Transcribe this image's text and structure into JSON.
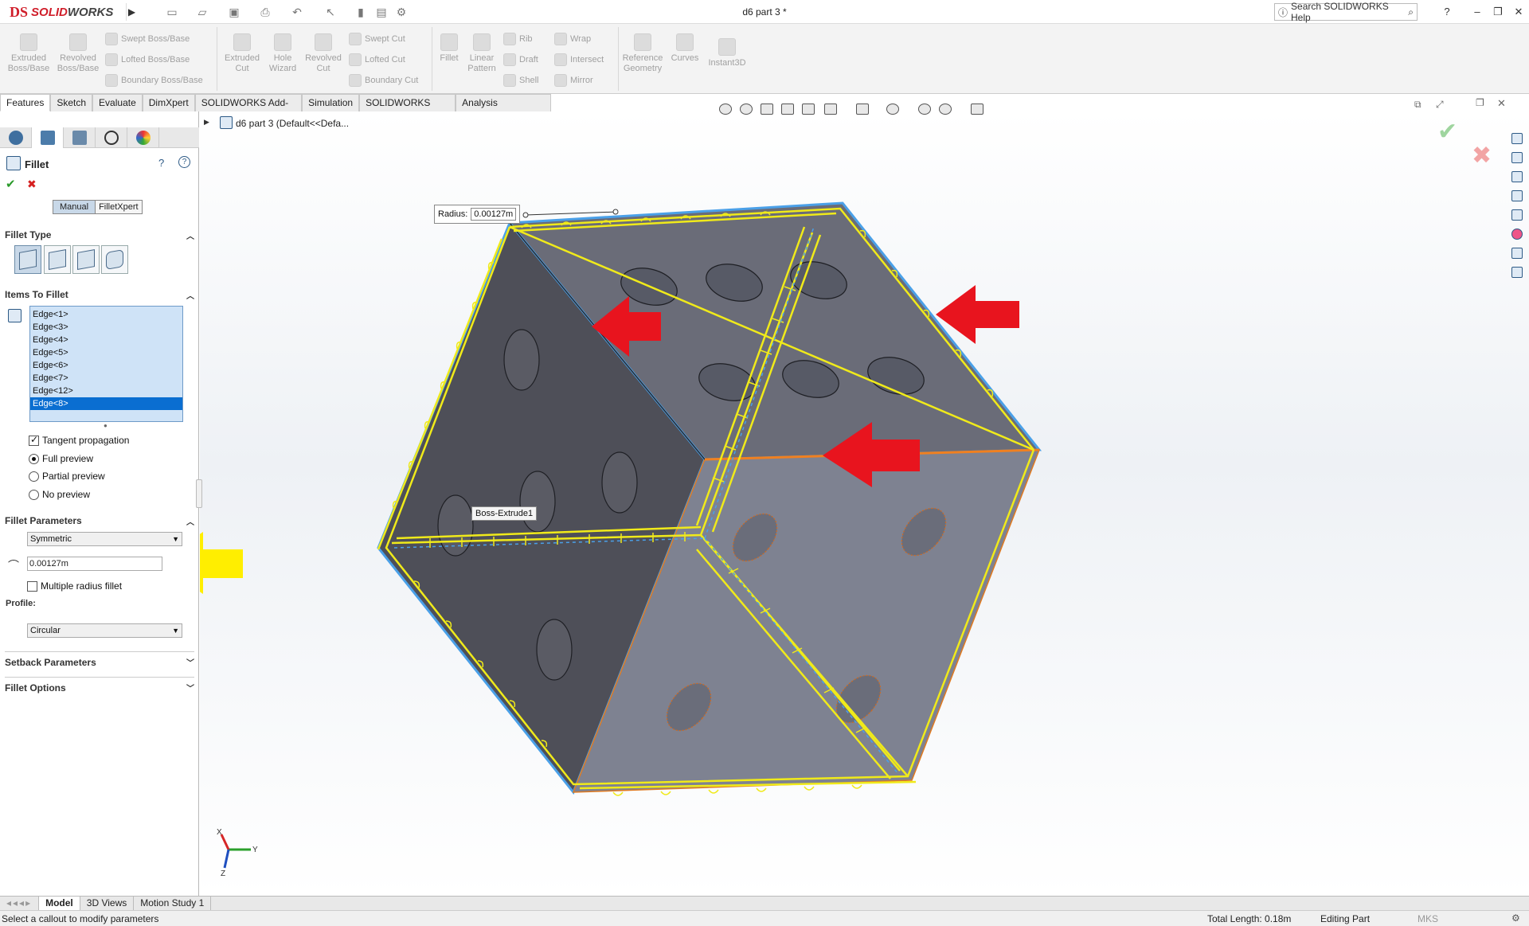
{
  "app": {
    "title": "d6 part 3 *",
    "logo_prefix": "DS",
    "logo_solid": "SOLID",
    "logo_works": "WORKS",
    "search_label": "Search SOLIDWORKS Help"
  },
  "toolbar": {
    "extruded_boss": "Extruded Boss/Base",
    "revolved_boss": "Revolved Boss/Base",
    "swept_boss": "Swept Boss/Base",
    "lofted_boss": "Lofted Boss/Base",
    "boundary_boss": "Boundary Boss/Base",
    "extruded_cut": "Extruded Cut",
    "hole_wizard": "Hole Wizard",
    "revolved_cut": "Revolved Cut",
    "swept_cut": "Swept Cut",
    "lofted_cut": "Lofted Cut",
    "boundary_cut": "Boundary Cut",
    "fillet": "Fillet",
    "linear_pattern": "Linear Pattern",
    "rib": "Rib",
    "draft": "Draft",
    "shell": "Shell",
    "wrap": "Wrap",
    "intersect": "Intersect",
    "mirror": "Mirror",
    "reference_geometry": "Reference Geometry",
    "curves": "Curves",
    "instant3d": "Instant3D"
  },
  "command_tabs": [
    "Features",
    "Sketch",
    "Evaluate",
    "DimXpert",
    "SOLIDWORKS Add-Ins",
    "Simulation",
    "SOLIDWORKS MBD",
    "Analysis Preparation"
  ],
  "tree": {
    "root_label": "d6 part 3  (Default<<Defa..."
  },
  "fillet_panel": {
    "title": "Fillet",
    "mode_manual": "Manual",
    "mode_xpert": "FilletXpert",
    "fillet_type_header": "Fillet Type",
    "items_header": "Items To Fillet",
    "edges": [
      "Edge<1>",
      "Edge<3>",
      "Edge<4>",
      "Edge<5>",
      "Edge<6>",
      "Edge<7>",
      "Edge<12>",
      "Edge<8>"
    ],
    "selected_edge": "Edge<8>",
    "tangent_propagation": "Tangent propagation",
    "tangent_checked": true,
    "full_preview": "Full preview",
    "partial_preview": "Partial preview",
    "no_preview": "No preview",
    "preview_selected": "Full preview",
    "params_header": "Fillet Parameters",
    "symmetric": "Symmetric",
    "radius_value": "0.00127m",
    "multiple_radius": "Multiple radius fillet",
    "profile_label": "Profile:",
    "profile_value": "Circular",
    "setback_header": "Setback Parameters",
    "options_header": "Fillet Options"
  },
  "viewport": {
    "radius_callout_label": "Radius:",
    "radius_callout_value": "0.00127m",
    "boss_tooltip": "Boss-Extrude1",
    "axis_y": "Y",
    "axis_x": "X",
    "axis_z": "Z",
    "colors": {
      "selection_yellow": "#f0ea1a",
      "arrow_red": "#e8141e",
      "arrow_yellow": "#ffee00",
      "edge_blue": "#4aa0e8",
      "edge_orange": "#f08020",
      "face_left": "#4e4f58",
      "face_top": "#6a6c78",
      "face_right": "#7e8291"
    }
  },
  "bottom_tabs": [
    "Model",
    "3D Views",
    "Motion Study 1"
  ],
  "status": {
    "message": "Select a callout to modify parameters",
    "total_length": "Total Length: 0.18m",
    "mode": "Editing Part",
    "units": "MKS"
  }
}
